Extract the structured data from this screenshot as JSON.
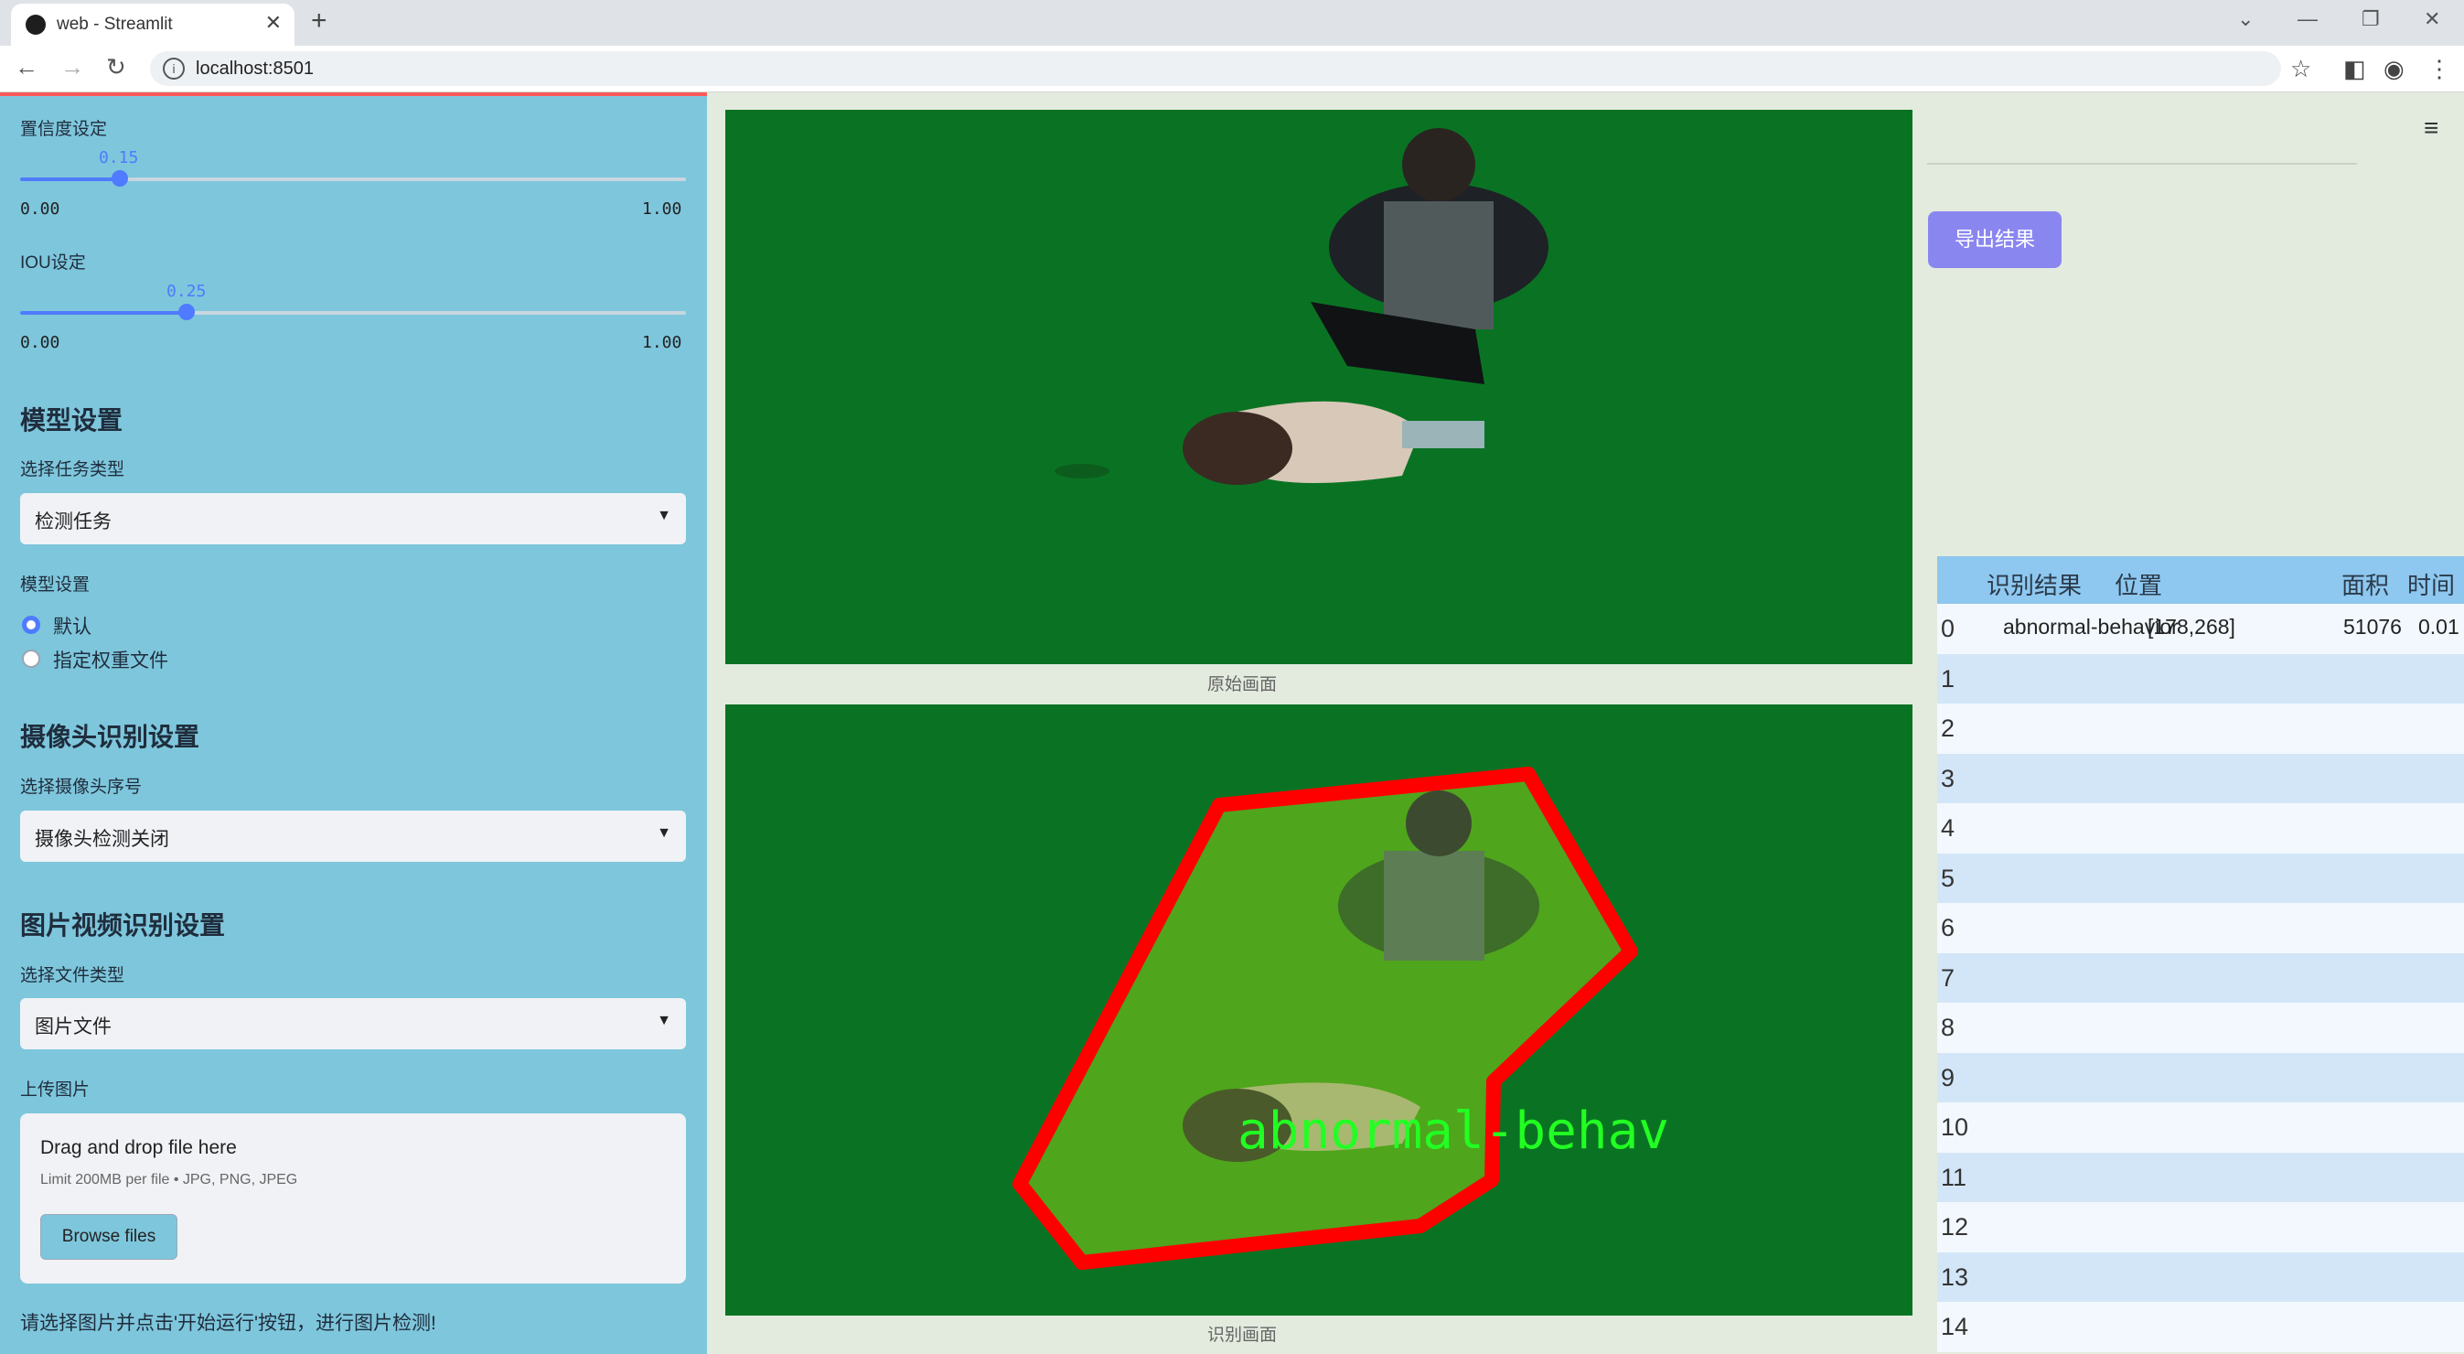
{
  "browser": {
    "tab_title": "web - Streamlit",
    "url": "localhost:8501"
  },
  "sidebar": {
    "conf": {
      "label": "置信度设定",
      "value": "0.15",
      "fraction": 0.15,
      "min": "0.00",
      "max": "1.00"
    },
    "iou": {
      "label": "IOU设定",
      "value": "0.25",
      "fraction": 0.25,
      "min": "0.00",
      "max": "1.00"
    },
    "model_section": "模型设置",
    "task_label": "选择任务类型",
    "task_value": "检测任务",
    "model_label": "模型设置",
    "model_options": [
      "默认",
      "指定权重文件"
    ],
    "camera_section": "摄像头识别设置",
    "camera_label": "选择摄像头序号",
    "camera_value": "摄像头检测关闭",
    "media_section": "图片视频识别设置",
    "filetype_label": "选择文件类型",
    "filetype_value": "图片文件",
    "upload_label": "上传图片",
    "upload": {
      "title": "Drag and drop file here",
      "limit": "Limit 200MB per file • JPG, PNG, JPEG",
      "browse": "Browse files"
    },
    "hint": "请选择图片并点击'开始运行'按钮，进行图片检测!"
  },
  "main": {
    "caption_original": "原始画面",
    "caption_detected": "识别画面",
    "detection_label": "abnormal-behav",
    "export_button": "导出结果"
  },
  "table": {
    "headers": [
      "识别结果",
      "位置",
      "面积",
      "时间"
    ],
    "row0": {
      "index": "0",
      "result": "abnormal-behavior",
      "position": "[178,268]",
      "area": "51076",
      "time": "0.01"
    },
    "indices": [
      "1",
      "2",
      "3",
      "4",
      "5",
      "6",
      "7",
      "8",
      "9",
      "10",
      "11",
      "12",
      "13",
      "14"
    ]
  },
  "colors": {
    "sidebar": "#7ec6dc",
    "accent": "#4e7bff",
    "export": "#8a86f0",
    "detection": "#ff0000"
  }
}
